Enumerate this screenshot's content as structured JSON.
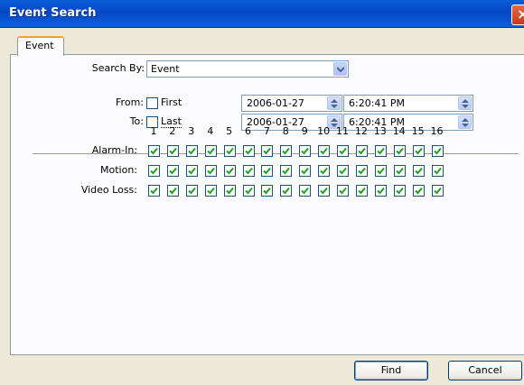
{
  "window": {
    "title": "Event Search"
  },
  "tab": {
    "label": "Event"
  },
  "search_by": {
    "label": "Search By:",
    "value": "Event"
  },
  "from": {
    "label": "From:",
    "checkbox_label": "First",
    "checked": false,
    "date": "2006-01-27",
    "time": "6:20:41 PM"
  },
  "to": {
    "label": "To:",
    "checkbox_label": "Last",
    "checked": false,
    "date": "2006-01-27",
    "time": "6:20:41 PM"
  },
  "channels": [
    "1",
    "2",
    "3",
    "4",
    "5",
    "6",
    "7",
    "8",
    "9",
    "10",
    "11",
    "12",
    "13",
    "14",
    "15",
    "16"
  ],
  "rows": [
    {
      "label": "Alarm-In:",
      "checked": [
        true,
        true,
        true,
        true,
        true,
        true,
        true,
        true,
        true,
        true,
        true,
        true,
        true,
        true,
        true,
        true
      ]
    },
    {
      "label": "Motion:",
      "checked": [
        true,
        true,
        true,
        true,
        true,
        true,
        true,
        true,
        true,
        true,
        true,
        true,
        true,
        true,
        true,
        true
      ]
    },
    {
      "label": "Video Loss:",
      "checked": [
        true,
        true,
        true,
        true,
        true,
        true,
        true,
        true,
        true,
        true,
        true,
        true,
        true,
        true,
        true,
        true
      ]
    }
  ],
  "buttons": {
    "find": "Find",
    "cancel": "Cancel"
  },
  "colors": {
    "titlebar": "#0a5ed8",
    "check": "#21a121",
    "tab_highlight": "#f7a22f"
  }
}
